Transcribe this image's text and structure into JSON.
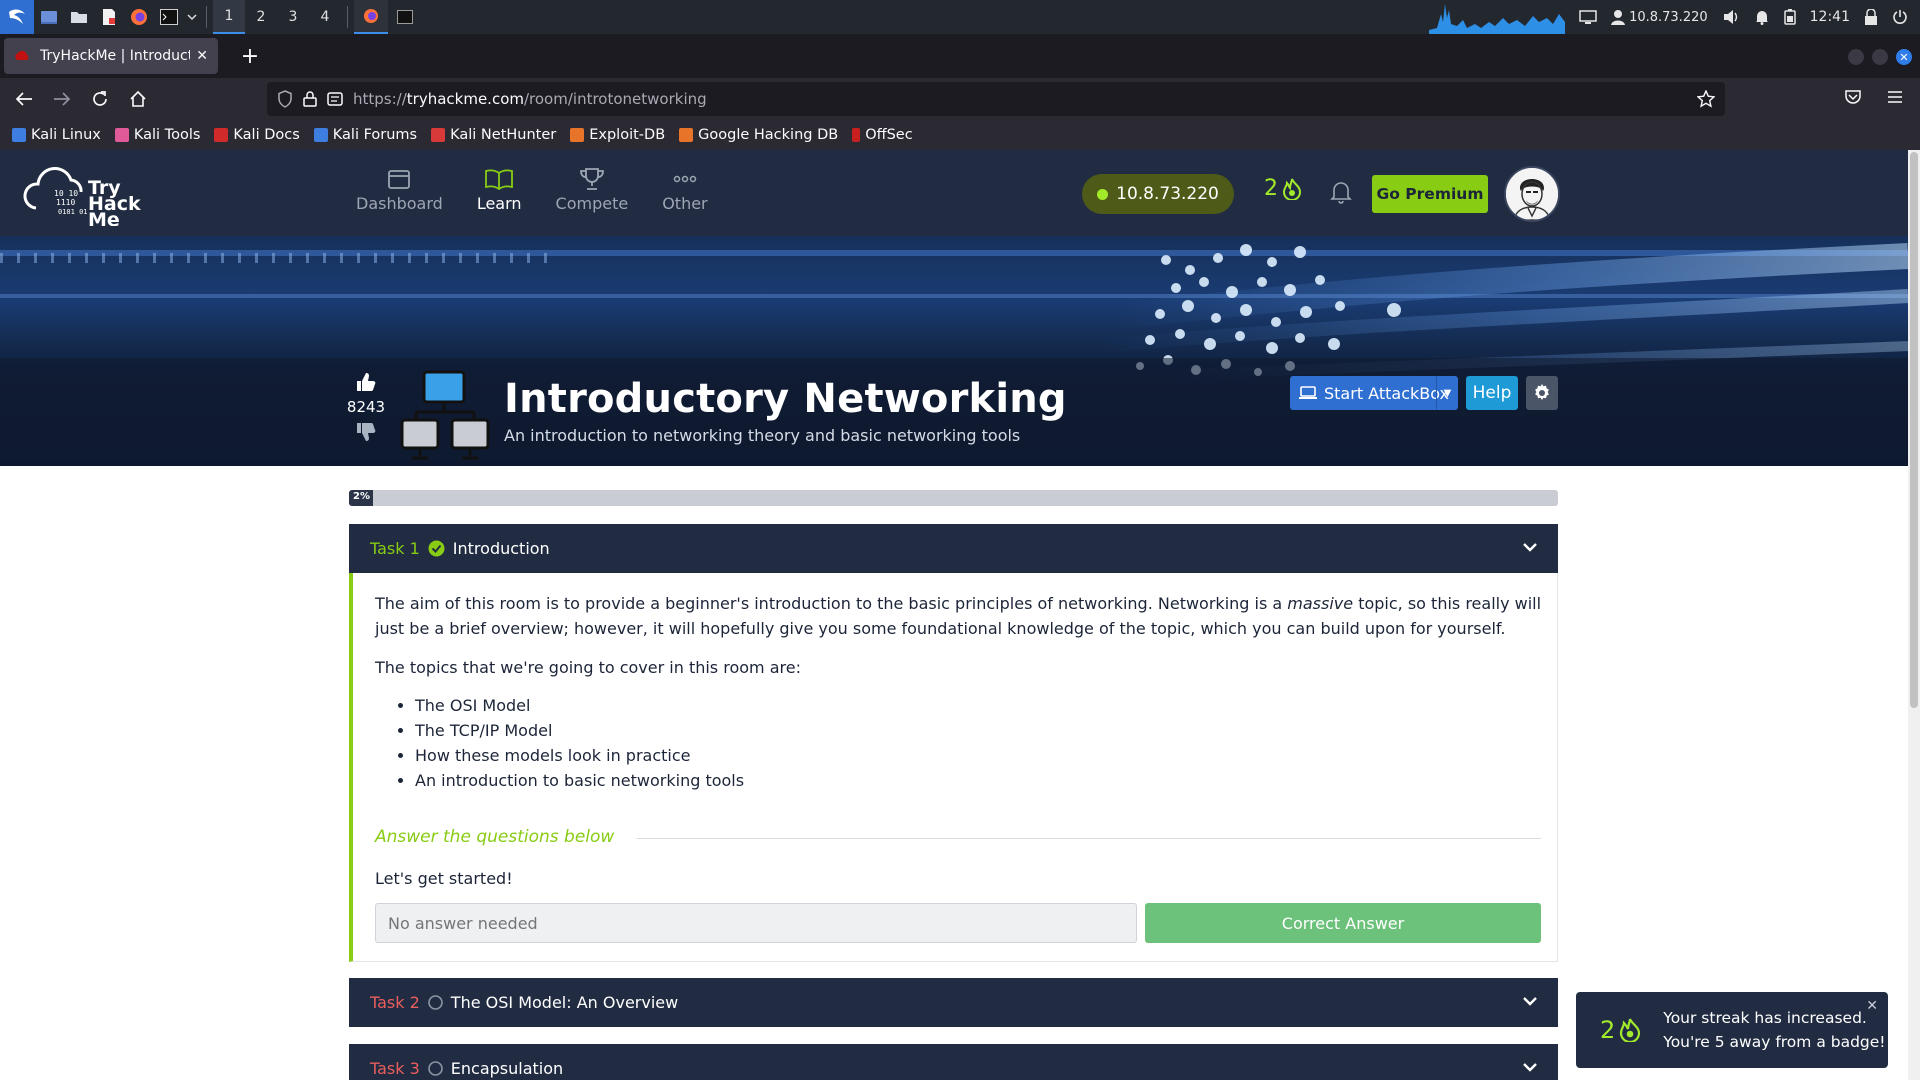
{
  "os": {
    "workspaces": [
      "1",
      "2",
      "3",
      "4"
    ],
    "active_workspace": "1",
    "vpn_ip": "10.8.73.220",
    "clock": "12:41"
  },
  "browser": {
    "tab_title": "TryHackMe | Introductory",
    "url_prefix": "https://",
    "url_host": "tryhackme.com",
    "url_path": "/room/introtonetworking",
    "bookmarks": [
      "Kali Linux",
      "Kali Tools",
      "Kali Docs",
      "Kali Forums",
      "Kali NetHunter",
      "Exploit-DB",
      "Google Hacking DB",
      "OffSec"
    ]
  },
  "thm": {
    "logo": {
      "line1": "Try",
      "line2": "Hack",
      "line3": "Me"
    },
    "menu": [
      "Dashboard",
      "Learn",
      "Compete",
      "Other"
    ],
    "active_menu": "Learn",
    "ip": "10.8.73.220",
    "streak": "2",
    "premium_label": "Go Premium",
    "brand_colors": {
      "green": "#88cc14",
      "navy": "#212c42",
      "blue": "#2f6fd1"
    }
  },
  "room": {
    "votes": "8243",
    "title": "Introductory Networking",
    "subtitle": "An introduction to networking theory and basic networking tools",
    "attackbox_label": "Start AttackBox",
    "help_label": "Help",
    "progress_label": "2%",
    "progress_value": 0.02
  },
  "tasks": [
    {
      "num": "Task 1",
      "title": "Introduction",
      "done": true,
      "para1_a": "The aim of this room is to provide a beginner's introduction to the basic principles of networking. Networking is a ",
      "para1_em": "massive",
      "para1_b": " topic, so this really will just be a brief overview; however, it will hopefully give you some foundational knowledge of the topic, which you can build upon for yourself.",
      "para2": "The topics that we're going to cover in this room are:",
      "bullets": [
        "The OSI Model",
        "The TCP/IP Model",
        "How these models look in practice",
        "An introduction to basic networking tools"
      ],
      "answer_header": "Answer the questions below",
      "question": "Let's get started!",
      "answer_placeholder": "No answer needed",
      "answer_button": "Correct Answer"
    },
    {
      "num": "Task 2",
      "title": "The OSI Model: An Overview",
      "done": false
    },
    {
      "num": "Task 3",
      "title": "Encapsulation",
      "done": false
    }
  ],
  "toast": {
    "streak": "2",
    "line1": "Your streak has increased.",
    "line2": "You're 5 away from a badge!"
  }
}
